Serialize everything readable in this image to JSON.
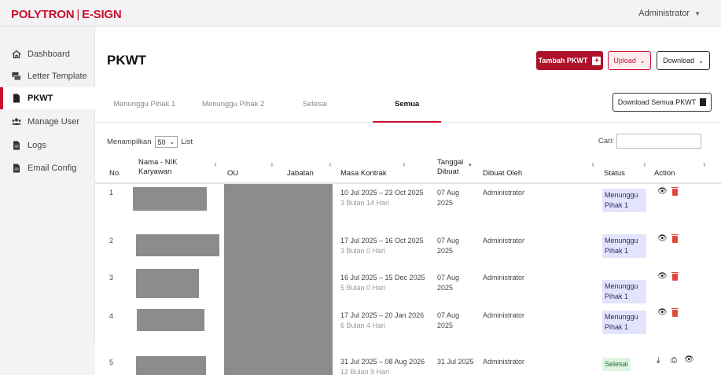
{
  "header": {
    "brand": "POLYTRON",
    "brand_product": "E-SIGN",
    "user": "Administrator"
  },
  "sidebar": {
    "items": [
      {
        "label": "Dashboard",
        "icon": "home-icon"
      },
      {
        "label": "Letter Template",
        "icon": "template-icon"
      },
      {
        "label": "PKWT",
        "icon": "document-icon",
        "active": true
      },
      {
        "label": "Manage User",
        "icon": "users-icon"
      },
      {
        "label": "Logs",
        "icon": "file-icon"
      },
      {
        "label": "Email Config",
        "icon": "file-icon"
      }
    ]
  },
  "main": {
    "title": "PKWT",
    "buttons": {
      "tambah": "Tambah PKWT",
      "upload": "Upload",
      "download": "Download",
      "download_all": "Download Semua PKWT"
    },
    "tabs": [
      "Menunggu Pihak 1",
      "Menunggu Pihak 2",
      "Selesai",
      "Semua"
    ],
    "active_tab": "Semua",
    "show": {
      "prefix": "Menampilkan",
      "value": "50",
      "suffix": "List"
    },
    "search_label": "Cari:",
    "columns": [
      "No.",
      "Nama - NIK Karyawan",
      "OU",
      "Jabatan",
      "Masa Kontrak",
      "Tanggal Dibuat",
      "Dibuat Oleh",
      "Status",
      "Action"
    ],
    "rows": [
      {
        "no": "1",
        "contract": "10 Jul 2025 – 23 Oct 2025",
        "duration": "3 Bulan 14 Hari",
        "created": "07 Aug 2025",
        "by": "Administrator",
        "status": "Menunggu Pihak 1"
      },
      {
        "no": "2",
        "contract": "17 Jul 2025 – 16 Oct 2025",
        "duration": "3 Bulan 0 Hari",
        "created": "07 Aug 2025",
        "by": "Administrator",
        "status": "Menunggu Pihak 1"
      },
      {
        "no": "3",
        "contract": "16 Jul 2025 – 15 Dec 2025",
        "duration": "5 Bulan 0 Hari",
        "created": "07 Aug 2025",
        "by": "Administrator",
        "status": "Menunggu Pihak 1"
      },
      {
        "no": "4",
        "contract": "17 Jul 2025 – 20 Jan 2026",
        "duration": "6 Bulan 4 Hari",
        "created": "07 Aug 2025",
        "by": "Administrator",
        "status": "Menunggu Pihak 1"
      },
      {
        "no": "5",
        "contract": "31 Jul 2025 – 08 Aug 2026",
        "duration": "12 Bulan 9 Hari",
        "created": "31 Jul 2025",
        "by": "Administrator",
        "status": "Selesai"
      }
    ]
  },
  "colors": {
    "brand": "#c8102e",
    "badge_pending": "#e3e4fb",
    "badge_done": "#dff5e3"
  }
}
